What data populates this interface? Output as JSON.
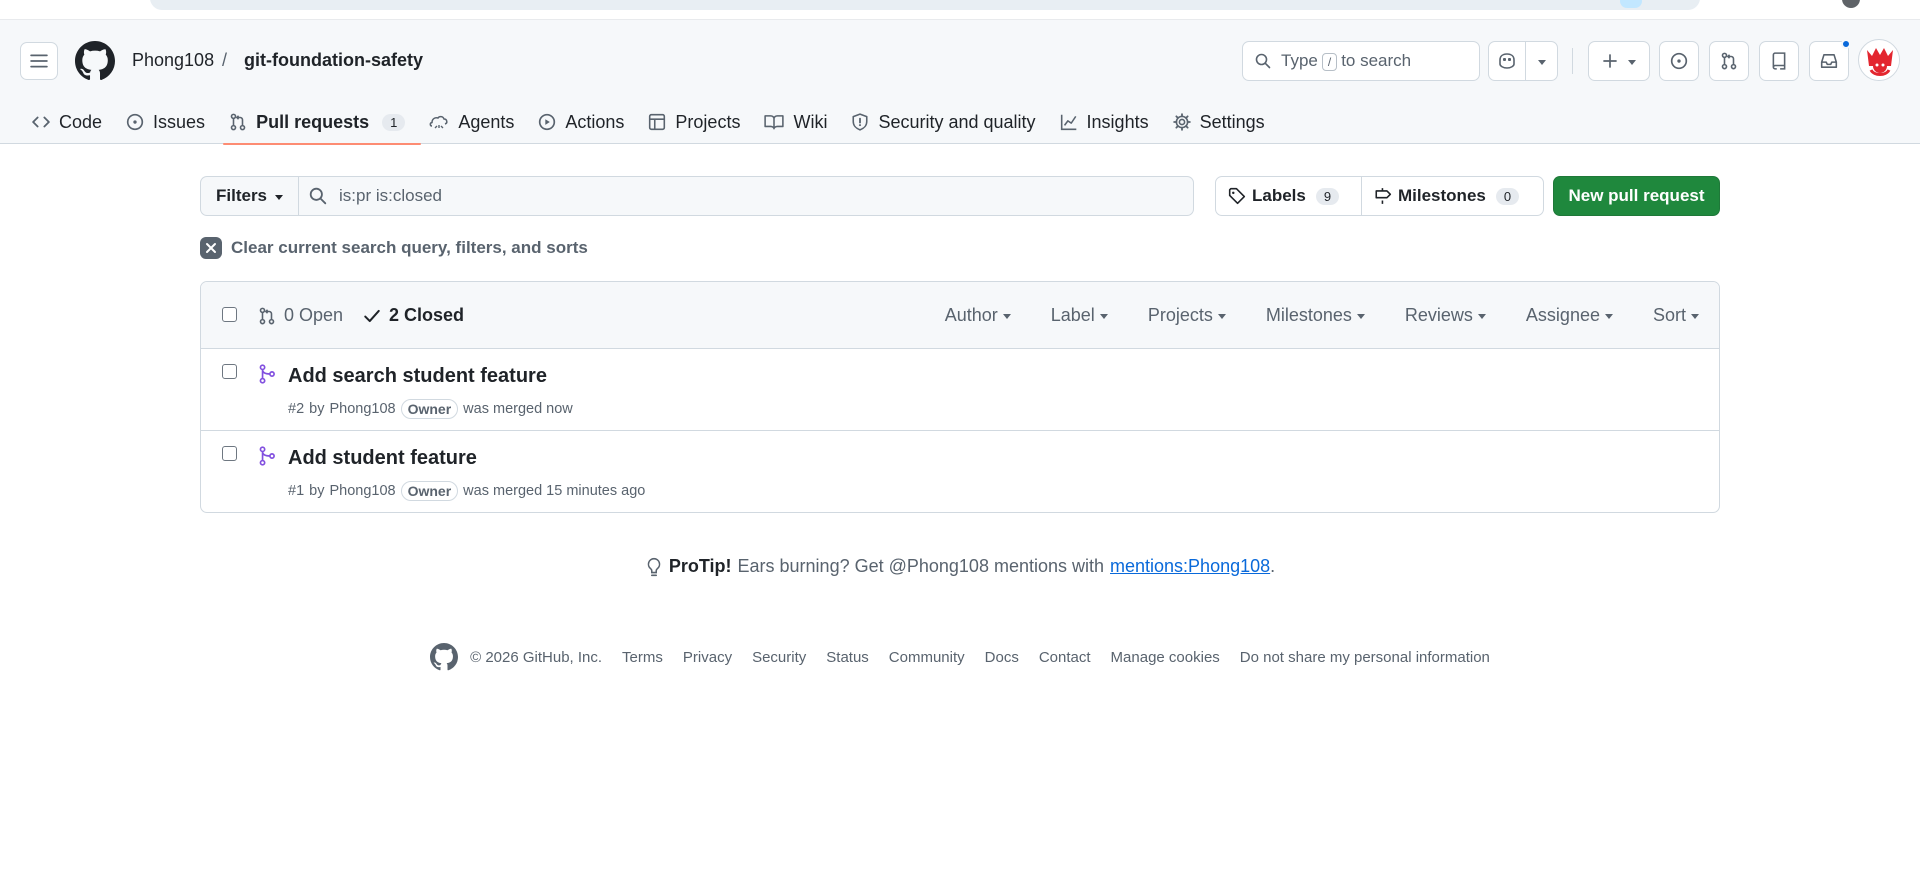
{
  "repo": {
    "owner": "Phong108",
    "separator": "/",
    "name": "git-foundation-safety"
  },
  "search": {
    "prefix": "Type",
    "key": "/",
    "suffix": "to search"
  },
  "nav": {
    "code": "Code",
    "issues": "Issues",
    "pulls": "Pull requests",
    "pulls_count": "1",
    "agents": "Agents",
    "actions": "Actions",
    "projects": "Projects",
    "wiki": "Wiki",
    "security": "Security and quality",
    "insights": "Insights",
    "settings": "Settings"
  },
  "filterbar": {
    "filters_label": "Filters",
    "query": "is:pr is:closed",
    "labels_label": "Labels",
    "labels_count": "9",
    "milestones_label": "Milestones",
    "milestones_count": "0",
    "new_pr_label": "New pull request",
    "clear_label": "Clear current search query, filters, and sorts"
  },
  "list_header": {
    "open_label": "0 Open",
    "closed_label": "2 Closed",
    "sorters": [
      "Author",
      "Label",
      "Projects",
      "Milestones",
      "Reviews",
      "Assignee",
      "Sort"
    ]
  },
  "pull_requests": [
    {
      "title": "Add search student feature",
      "number": "#2",
      "by": "by",
      "author": "Phong108",
      "badge": "Owner",
      "status": "was merged now"
    },
    {
      "title": "Add student feature",
      "number": "#1",
      "by": "by",
      "author": "Phong108",
      "badge": "Owner",
      "status": "was merged 15 minutes ago"
    }
  ],
  "protip": {
    "label": "ProTip!",
    "text": "Ears burning? Get @Phong108 mentions with",
    "link": "mentions:Phong108",
    "end": "."
  },
  "footer": {
    "copyright": "© 2026 GitHub, Inc.",
    "links": [
      "Terms",
      "Privacy",
      "Security",
      "Status",
      "Community",
      "Docs",
      "Contact",
      "Manage cookies",
      "Do not share my personal information"
    ]
  },
  "colors": {
    "accent": "#0969da",
    "merged": "#8250df",
    "primary_button": "#1f883d",
    "nav_underline": "#fd8c73"
  }
}
